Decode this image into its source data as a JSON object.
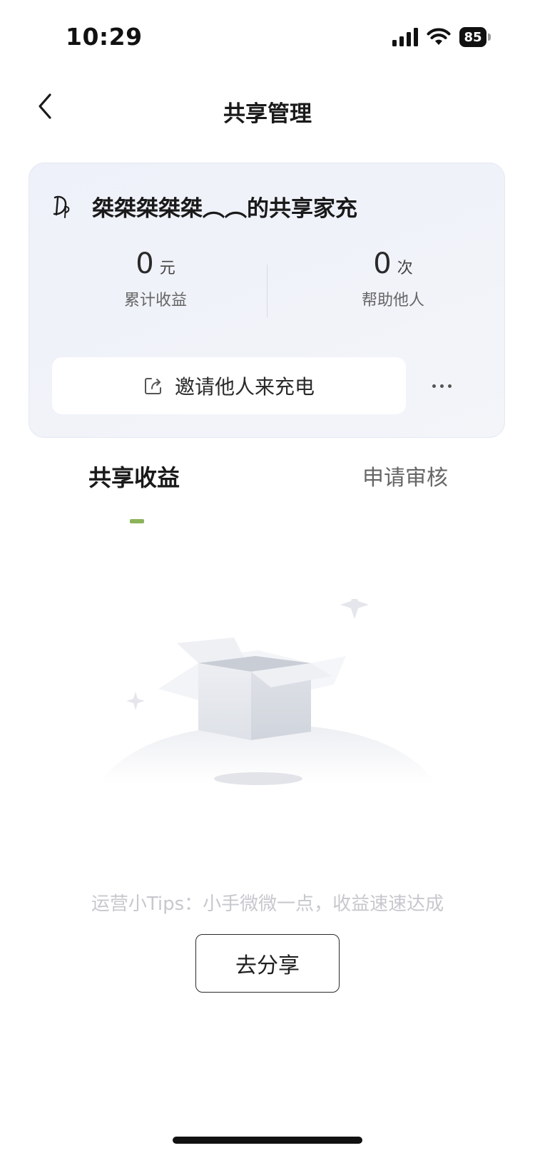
{
  "status_bar": {
    "time": "10:29",
    "battery_level": "85",
    "icons": [
      "signal-icon",
      "wifi-icon",
      "battery-icon"
    ]
  },
  "nav": {
    "title": "共享管理",
    "back_icon": "chevron-left-icon"
  },
  "card": {
    "avatar_icon": "dp-logo-icon",
    "title": "桀桀桀桀桀︵︵的共享家充",
    "stats": {
      "earnings": {
        "value": "0",
        "unit": "元",
        "label": "累计收益"
      },
      "helped": {
        "value": "0",
        "unit": "次",
        "label": "帮助他人"
      }
    },
    "invite_label": "邀请他人来充电",
    "invite_icon": "share-icon",
    "more_icon": "more-dots-icon"
  },
  "tabs": {
    "items": [
      {
        "label": "共享收益",
        "active": true
      },
      {
        "label": "申请审核",
        "active": false
      }
    ]
  },
  "empty_state": {
    "illustration": "open-box-illustration",
    "tips": "运营小Tips：小手微微一点，收益速速达成",
    "action_label": "去分享"
  },
  "colors": {
    "accent": "#8cb35a",
    "card_bg": "#eef1f9",
    "tips_text": "#c6c8cd"
  }
}
